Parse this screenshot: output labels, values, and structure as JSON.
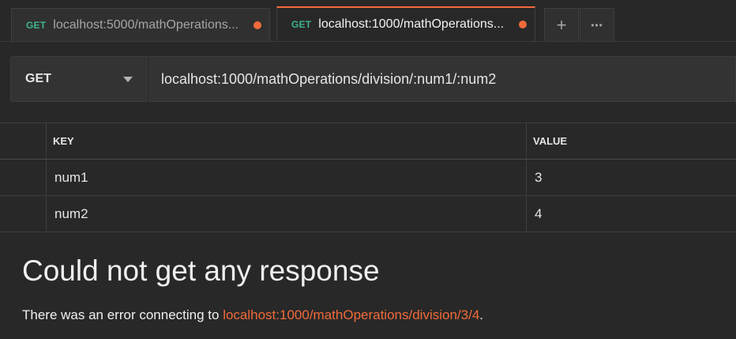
{
  "tabs": [
    {
      "method": "GET",
      "title": "localhost:5000/mathOperations...",
      "unsaved": true,
      "active": false
    },
    {
      "method": "GET",
      "title": "localhost:1000/mathOperations...",
      "unsaved": true,
      "active": true
    }
  ],
  "tab_actions": {
    "new_tab_icon": "plus-icon",
    "new_tab_glyph": "+",
    "more_icon": "ellipsis-icon",
    "more_glyph": "•••"
  },
  "request": {
    "method": "GET",
    "url": "localhost:1000/mathOperations/division/:num1/:num2"
  },
  "params": {
    "headers": {
      "key": "KEY",
      "value": "VALUE"
    },
    "rows": [
      {
        "key": "num1",
        "value": "3"
      },
      {
        "key": "num2",
        "value": "4"
      }
    ]
  },
  "response": {
    "title": "Could not get any response",
    "message_prefix": "There was an error connecting to ",
    "link": "localhost:1000/mathOperations/division/3/4",
    "message_suffix": "."
  },
  "colors": {
    "background": "#282828",
    "accent": "#f26b3a",
    "method_get": "#3fb58a",
    "text": "#e6e6e6"
  }
}
